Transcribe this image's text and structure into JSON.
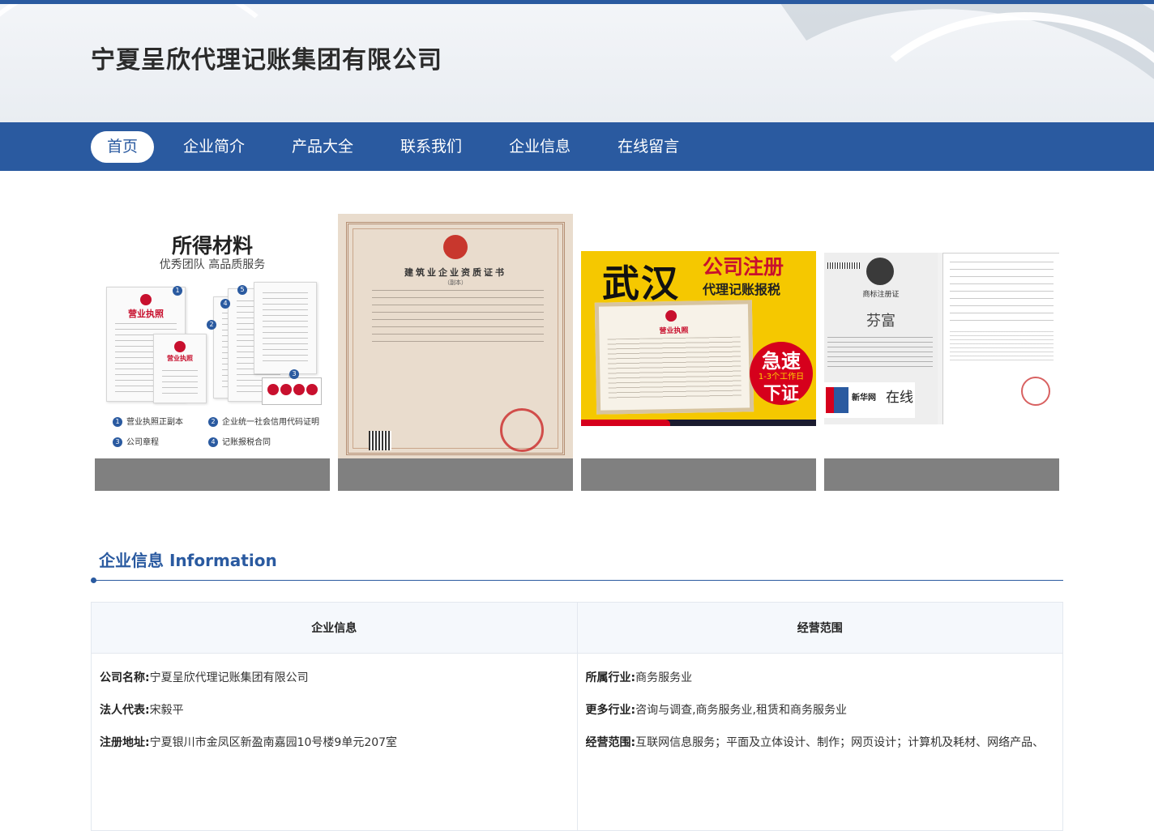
{
  "header": {
    "title": "宁夏呈欣代理记账集团有限公司"
  },
  "nav": {
    "items": [
      {
        "label": "首页",
        "active": true
      },
      {
        "label": "企业简介"
      },
      {
        "label": "产品大全"
      },
      {
        "label": "联系我们"
      },
      {
        "label": "企业信息"
      },
      {
        "label": "在线留言"
      }
    ]
  },
  "gallery": {
    "card1": {
      "title": "所得材料",
      "subtitle": "优秀团队  高品质服务",
      "doc_heading": "营业执照",
      "doc_heading_small": "营业执照",
      "legend": [
        "营业执照正副本",
        "企业统一社会信用代码证明",
        "公司章程",
        "记账报税合同"
      ]
    },
    "card2": {
      "cert_title": "建筑业企业资质证书",
      "cert_sub": "（副本）"
    },
    "card3": {
      "city": "武汉",
      "line1": "公司注册",
      "line2": "代理记账报税",
      "license": "营业执照",
      "badge1": "急速",
      "badge2": "1-3个工作日",
      "badge3": "下证"
    },
    "card4": {
      "heading": "商标注册证",
      "name": "芬富",
      "logo_text": "新华网",
      "logo_text2": "在线"
    }
  },
  "info_section": {
    "title": "企业信息 Information",
    "col_left_header": "企业信息",
    "col_right_header": "经营范围",
    "left_rows": [
      {
        "label": "公司名称:",
        "value": "宁夏呈欣代理记账集团有限公司"
      },
      {
        "label": "法人代表:",
        "value": "宋毅平"
      },
      {
        "label": "注册地址:",
        "value": "宁夏银川市金凤区新盈南嘉园10号楼9单元207室"
      }
    ],
    "right_rows": [
      {
        "label": "所属行业:",
        "value": "商务服务业"
      },
      {
        "label": "更多行业:",
        "value": "咨询与调查,商务服务业,租赁和商务服务业"
      },
      {
        "label": "经营范围:",
        "value": "互联网信息服务；平面及立体设计、制作；网页设计；计算机及耗材、网络产品、"
      }
    ]
  },
  "colors": {
    "brand_blue": "#2a5aa0",
    "caption_gray": "#808080"
  }
}
